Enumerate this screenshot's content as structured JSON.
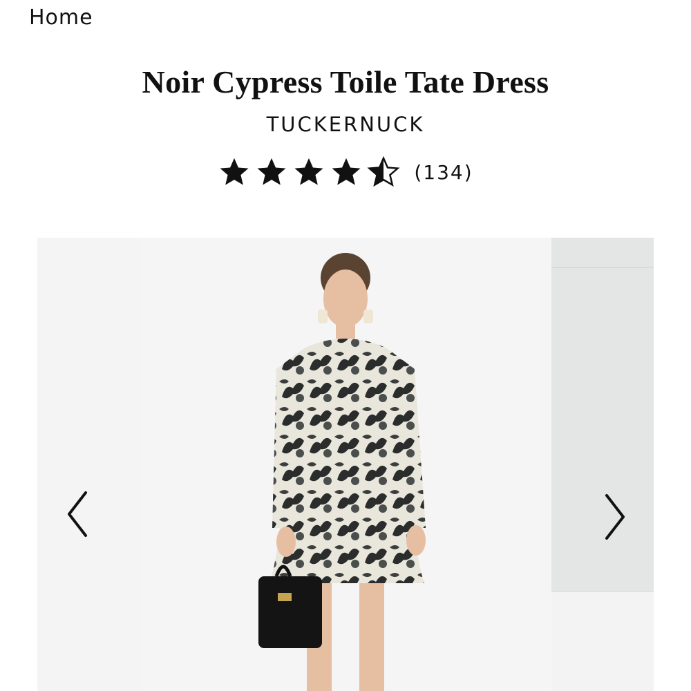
{
  "breadcrumb": {
    "label": "Home"
  },
  "product": {
    "title": "Noir Cypress Toile Tate Dress",
    "brand": "TUCKERNUCK",
    "rating": 4.5,
    "review_count": "(134)"
  },
  "gallery": {
    "prev_icon": "chevron-left-icon",
    "next_icon": "chevron-right-icon"
  },
  "colors": {
    "text": "#111111",
    "background": "#ffffff",
    "image_bg": "#f5f5f5"
  }
}
